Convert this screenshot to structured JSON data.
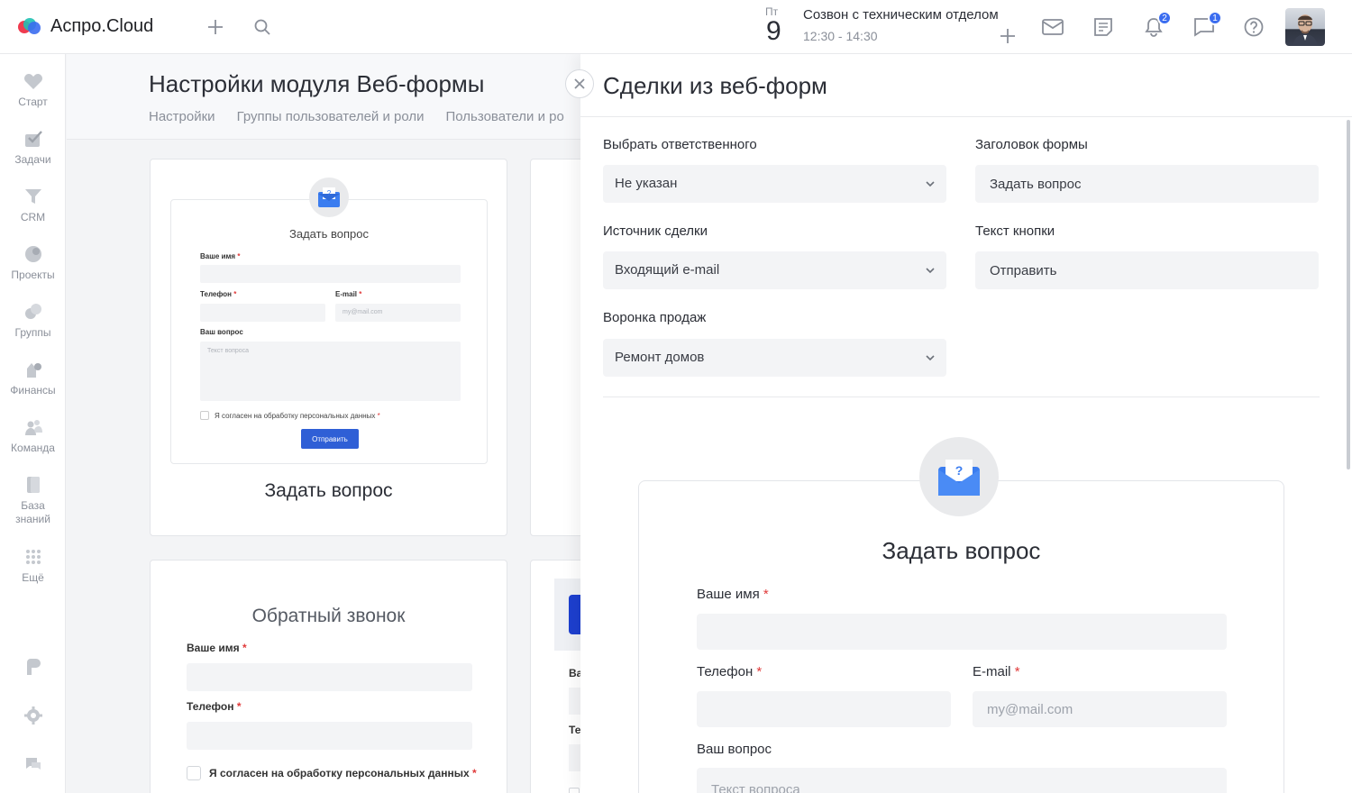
{
  "app": {
    "logo_text": "Аспро.Cloud",
    "colors": {
      "accent": "#3b6df0",
      "logo_red": "#ef3b4f",
      "logo_teal": "#20c1b3",
      "logo_blue": "#3b6df0"
    }
  },
  "topbar": {
    "icons": [
      "plus-icon",
      "search-icon",
      "mail-icon",
      "notes-icon",
      "bell-icon",
      "chat-icon",
      "help-icon"
    ],
    "event": {
      "day_of_week": "Пт",
      "day": "9",
      "title": "Созвон с техническим отделом",
      "time": "12:30 - 14:30"
    },
    "notifications_count": "2",
    "messages_count": "1"
  },
  "sidebar": {
    "items": [
      {
        "label": "Старт",
        "icon": "heart-icon"
      },
      {
        "label": "Задачи",
        "icon": "tasks-icon"
      },
      {
        "label": "CRM",
        "icon": "funnel-icon"
      },
      {
        "label": "Проекты",
        "icon": "projects-icon"
      },
      {
        "label": "Группы",
        "icon": "groups-icon"
      },
      {
        "label": "Финансы",
        "icon": "finance-icon"
      },
      {
        "label": "Команда",
        "icon": "team-icon"
      },
      {
        "label": "База знаний",
        "icon": "book-icon"
      },
      {
        "label": "Ещё",
        "icon": "grid-dots-icon"
      }
    ],
    "bottom_icons": [
      "brand-icon",
      "settings-icon",
      "support-chat-icon"
    ]
  },
  "background_page": {
    "title": "Настройки модуля Веб-формы",
    "tabs": [
      "Настройки",
      "Группы пользователей и роли",
      "Пользователи и ро"
    ],
    "card_ask": {
      "mini_title": "Задать вопрос",
      "name_label": "Ваше имя",
      "phone_label": "Телефон",
      "email_label": "E-mail",
      "email_placeholder": "my@mail.com",
      "question_label": "Ваш вопрос",
      "question_placeholder": "Текст вопроса",
      "consent": "Я согласен на обработку персональных данных",
      "submit": "Отправить",
      "caption": "Задать вопрос"
    },
    "card_callback": {
      "title": "Обратный звонок",
      "name_label": "Ваше имя",
      "phone_label": "Телефон",
      "consent": "Я согласен на обработку персональных данных"
    },
    "card_partial": {
      "label_1": "Ва",
      "label_2": "Те"
    }
  },
  "panel": {
    "title": "Сделки из веб-форм",
    "responsible_label": "Выбрать ответственного",
    "responsible_value": "Не указан",
    "source_label": "Источник сделки",
    "source_value": "Входящий e-mail",
    "funnel_label": "Воронка продаж",
    "funnel_value": "Ремонт домов",
    "form_title_label": "Заголовок формы",
    "form_title_value": "Задать вопрос",
    "button_text_label": "Текст кнопки",
    "button_text_value": "Отправить",
    "preview": {
      "title": "Задать вопрос",
      "name_label": "Ваше имя",
      "phone_label": "Телефон",
      "email_label": "E-mail",
      "email_placeholder": "my@mail.com",
      "question_label": "Ваш вопрос",
      "question_placeholder": "Текст вопроса"
    }
  }
}
